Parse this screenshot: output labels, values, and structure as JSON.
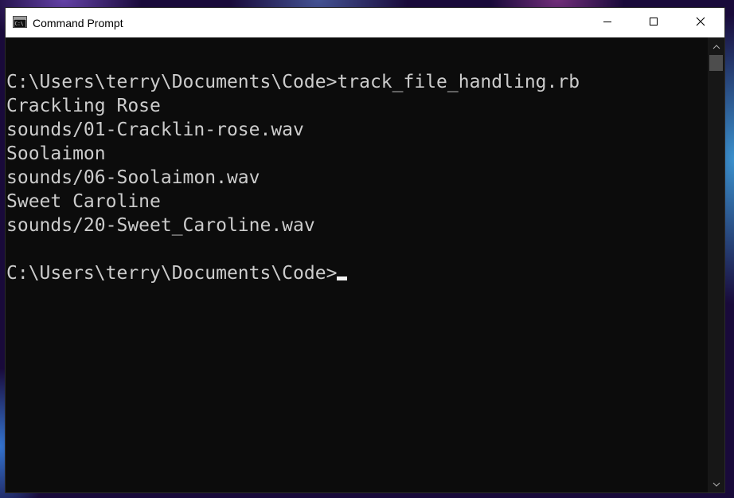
{
  "window": {
    "title": "Command Prompt",
    "icon": "cmd-console-icon",
    "controls": {
      "minimize": "minimize-icon",
      "maximize": "maximize-icon",
      "close": "close-icon"
    }
  },
  "console": {
    "lines": [
      "C:\\Users\\terry\\Documents\\Code>track_file_handling.rb",
      "Crackling Rose",
      "sounds/01-Cracklin-rose.wav",
      "Soolaimon",
      "sounds/06-Soolaimon.wav",
      "Sweet Caroline",
      "sounds/20-Sweet_Caroline.wav",
      ""
    ],
    "prompt": "C:\\Users\\terry\\Documents\\Code>"
  },
  "colors": {
    "console_background": "#0c0c0c",
    "console_text": "#cccccc",
    "titlebar_background": "#ffffff"
  }
}
